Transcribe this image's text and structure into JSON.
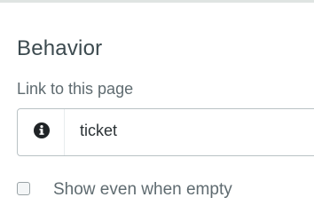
{
  "section": {
    "title": "Behavior"
  },
  "link_field": {
    "label": "Link to this page",
    "value": "ticket",
    "icon": "info-circle-icon"
  },
  "show_empty": {
    "label": "Show even when empty",
    "checked": false
  },
  "colors": {
    "title": "#3c4a4f",
    "label": "#5f6b70",
    "border": "#b9c2c5",
    "text": "#2b3235"
  }
}
